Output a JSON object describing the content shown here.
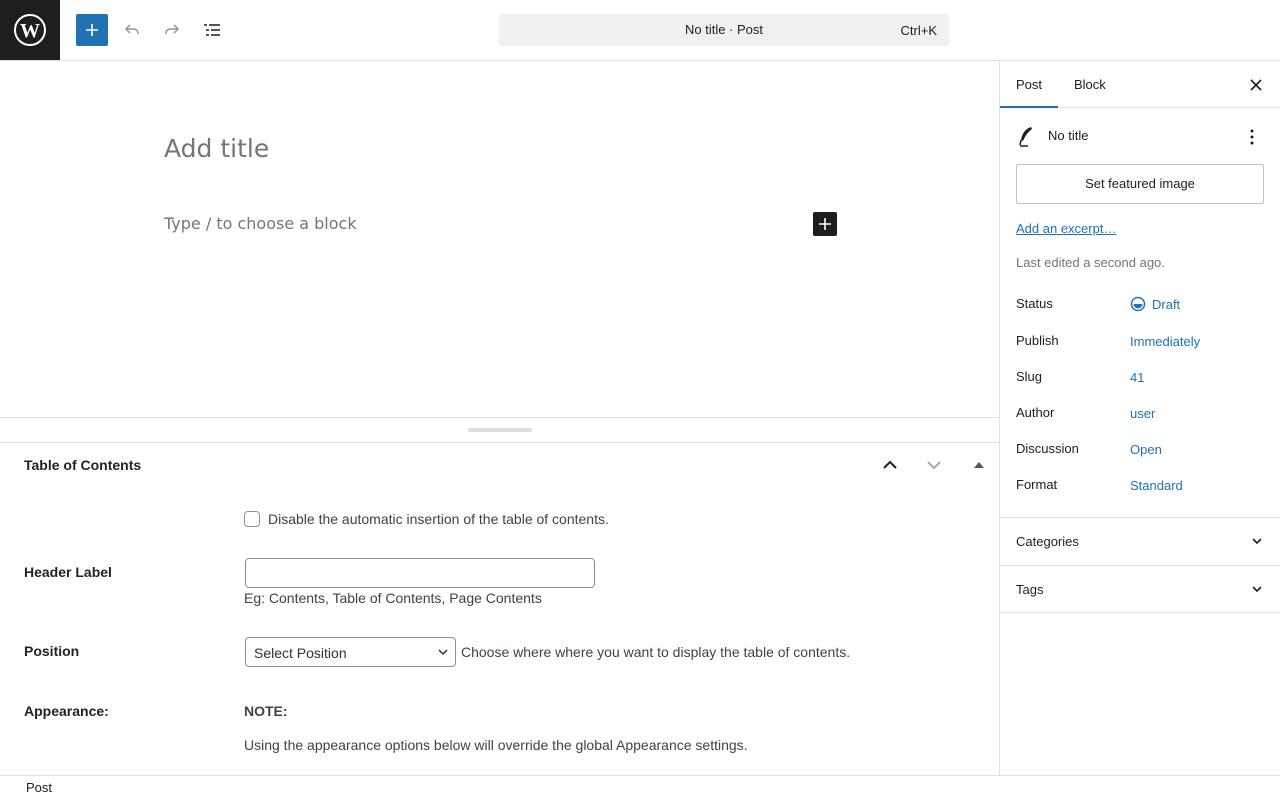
{
  "toolbar": {
    "logo_icon": "wordpress-logo-icon",
    "add_icon": "plus-icon",
    "undo_icon": "undo-icon",
    "redo_icon": "redo-icon",
    "outline_icon": "list-view-icon",
    "command_title": "No title · Post",
    "command_shortcut": "Ctrl+K",
    "accent": "#2271b1"
  },
  "editor": {
    "title_placeholder": "Add title",
    "block_placeholder": "Type / to choose a block",
    "inline_add_icon": "plus-icon"
  },
  "metabox": {
    "title": "Table of Contents",
    "checkbox_label": "Disable the automatic insertion of the table of contents.",
    "header_label": "Header Label",
    "header_value": "",
    "header_hint": "Eg: Contents, Table of Contents, Page Contents",
    "position_label": "Position",
    "position_selected": "Select Position",
    "position_hint": "Choose where where you want to display the table of contents.",
    "appearance_label": "Appearance:",
    "note_label": "NOTE:",
    "note_text": "Using the appearance options below will override the global Appearance settings."
  },
  "sidebar": {
    "tabs": [
      {
        "label": "Post",
        "active": true
      },
      {
        "label": "Block",
        "active": false
      }
    ],
    "post_name": "No title",
    "featured_image": "Set featured image",
    "excerpt_link": "Add an excerpt…",
    "last_edited": "Last edited a second ago.",
    "meta": [
      {
        "key": "Status",
        "value": "Draft"
      },
      {
        "key": "Publish",
        "value": "Immediately"
      },
      {
        "key": "Slug",
        "value": "41"
      },
      {
        "key": "Author",
        "value": "user"
      },
      {
        "key": "Discussion",
        "value": "Open"
      },
      {
        "key": "Format",
        "value": "Standard"
      }
    ],
    "panels": [
      {
        "label": "Categories"
      },
      {
        "label": "Tags"
      }
    ]
  },
  "footer": {
    "breadcrumb": "Post"
  }
}
